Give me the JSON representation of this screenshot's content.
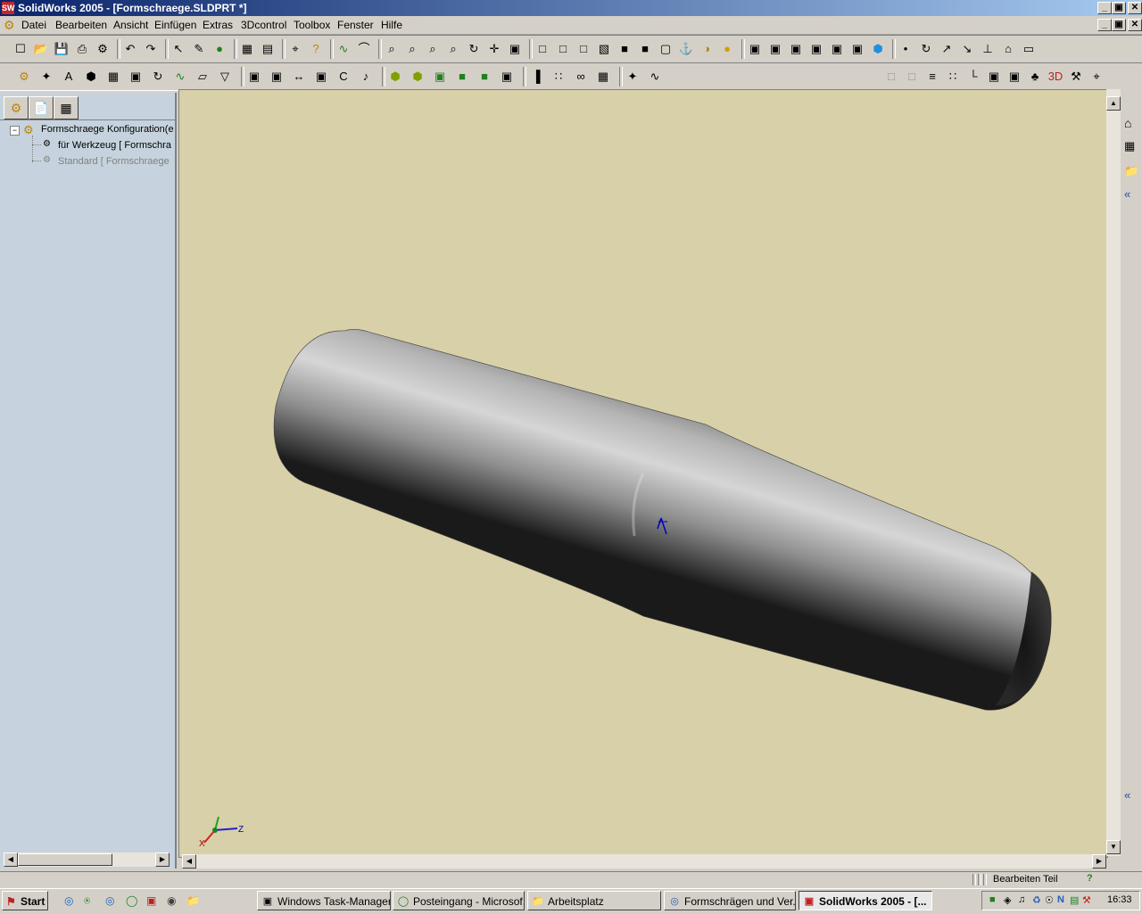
{
  "window": {
    "title": "SolidWorks 2005 - [Formschraege.SLDPRT *]",
    "controls": [
      "_",
      "▣",
      "✕"
    ]
  },
  "menu": [
    "Datei",
    "Bearbeiten",
    "Ansicht",
    "Einfügen",
    "Extras",
    "3Dcontrol",
    "Toolbox",
    "Fenster",
    "Hilfe"
  ],
  "toolbar1_icons": [
    "new-icon",
    "open-icon",
    "save-icon",
    "print-icon",
    "rebuild-icon",
    "undo-icon",
    "redo-icon",
    "select-icon",
    "sketch-icon",
    "traffic-light-icon",
    "grid-icon",
    "brick-icon",
    "measure-icon",
    "help-icon",
    "curve-icon",
    "curve2-icon",
    "zoom-fit-icon",
    "zoom-window-icon",
    "zoom-inout-icon",
    "zoom-selection-icon",
    "rotate-icon",
    "pan-icon",
    "view-orient-icon",
    "wireframe-icon",
    "hidden-lines-icon",
    "hidden-removed-icon",
    "shaded-edges-icon",
    "shaded-icon",
    "shadow-icon",
    "perspective-icon",
    "section-icon",
    "curvature-icon",
    "realview-icon",
    "front-view-icon",
    "back-view-icon",
    "left-view-icon",
    "right-view-icon",
    "top-view-icon",
    "bottom-view-icon",
    "iso-view-icon",
    "point-icon",
    "arc-icon",
    "line-icon",
    "arrow-icon",
    "ground-icon",
    "hat-icon",
    "ruler-icon"
  ],
  "toolbar2_icons": [
    "feature-icon",
    "reference-icon",
    "text-icon",
    "assembly-icon",
    "pattern-icon",
    "extrude-icon",
    "revolve-icon",
    "curve-icon",
    "plane-icon",
    "filter-icon",
    "box-icon",
    "box2-icon",
    "split-icon",
    "split2-icon",
    "c-icon",
    "bell-icon",
    "solid1-icon",
    "solid2-icon",
    "solid3-icon",
    "solid4-icon",
    "solid5-icon",
    "solid6-icon",
    "bar-icon",
    "pattern3-icon",
    "chain-icon",
    "table-icon",
    "plane2-icon",
    "curve3-icon"
  ],
  "toolbar2_right_icons": [
    "gray1-icon",
    "gray2-icon",
    "lines-icon",
    "dotted-icon",
    "axes-icon",
    "view-icon",
    "camera-icon",
    "tree-icon",
    "3d-icon",
    "tool-icon",
    "measure2-icon"
  ],
  "panel": {
    "tree": [
      {
        "label": "Formschraege Konfiguration(e",
        "level": 0
      },
      {
        "label": "für Werkzeug [ Formschra",
        "level": 1
      },
      {
        "label": "Standard [ Formschraege",
        "level": 1,
        "dim": true
      }
    ]
  },
  "viewport": {
    "bg_color": "#d8d0a8",
    "axes": {
      "x": "X",
      "y": "Y",
      "z": "Z"
    }
  },
  "status": {
    "mode": "Bearbeiten Teil",
    "help": "?"
  },
  "taskbar": {
    "start": "Start",
    "buttons": [
      {
        "label": "Windows Task-Manager",
        "icon": "taskmgr-icon"
      },
      {
        "label": "Posteingang - Microsof...",
        "icon": "outlook-icon"
      },
      {
        "label": "Arbeitsplatz",
        "icon": "folder-icon"
      },
      {
        "label": "Formschrägen und Ver...",
        "icon": "ie-icon"
      },
      {
        "label": "SolidWorks 2005 - [...",
        "icon": "solidworks-icon",
        "active": true
      }
    ],
    "clock": "16:33"
  }
}
